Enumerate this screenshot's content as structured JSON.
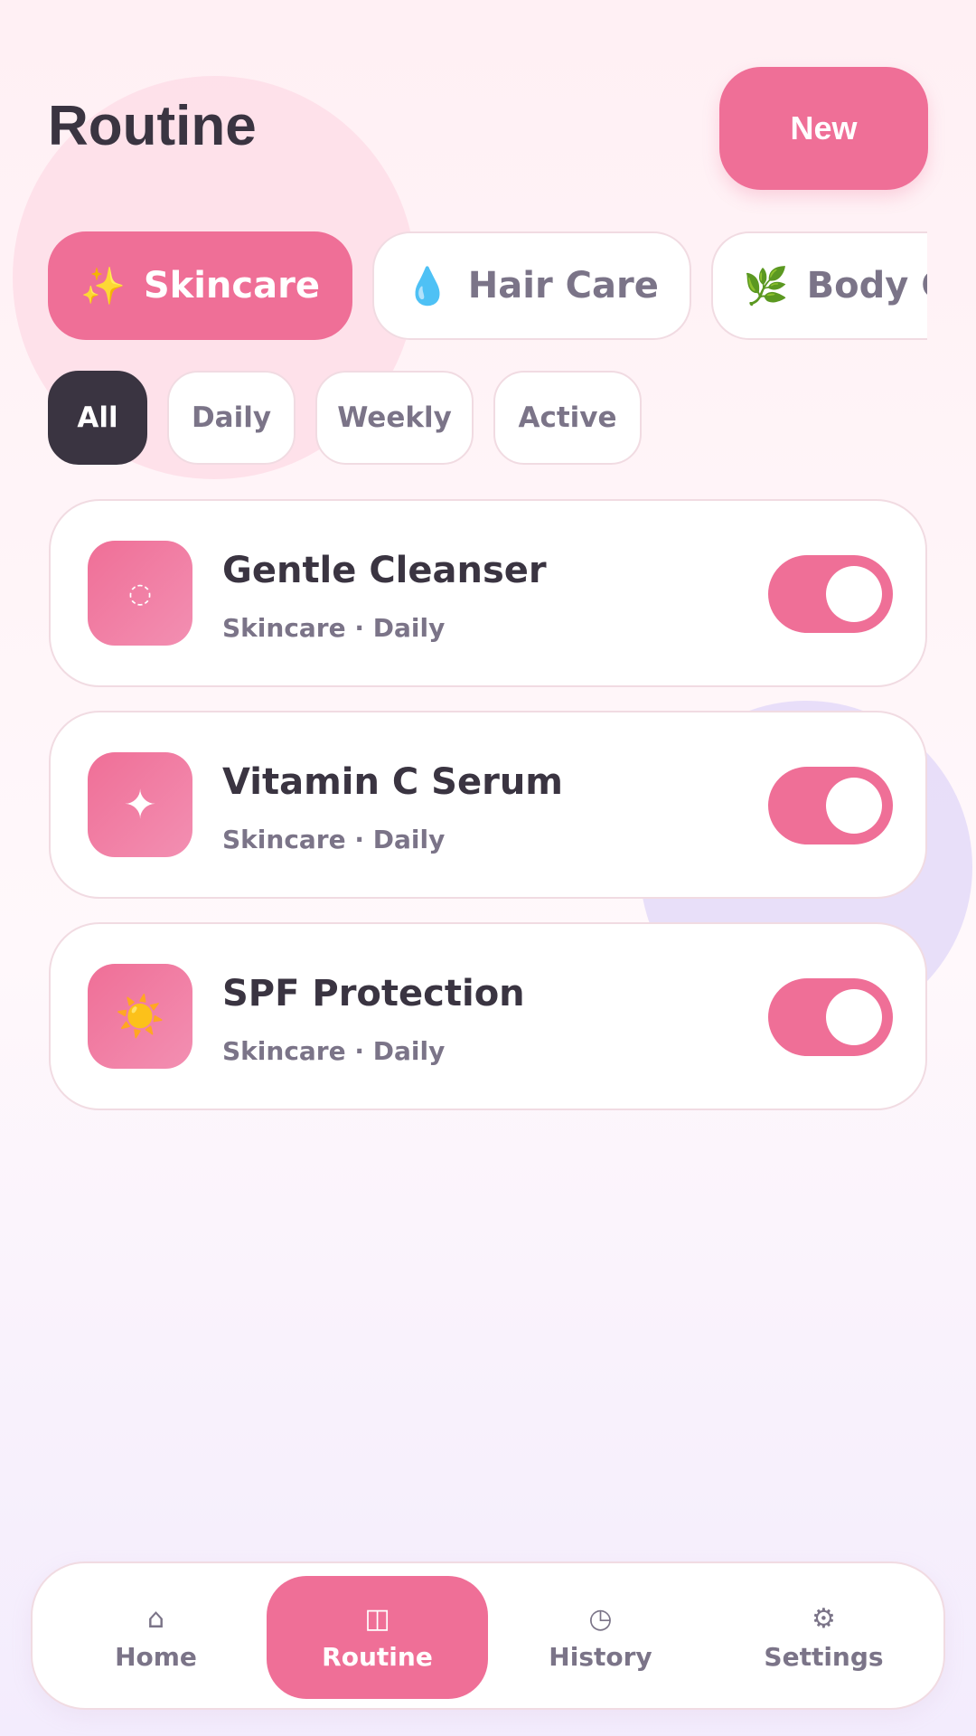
{
  "header": {
    "title": "Routine",
    "new_label": "New"
  },
  "categories": [
    {
      "icon": "sparkles-icon",
      "emoji": "✨",
      "label": "Skincare",
      "active": true
    },
    {
      "icon": "droplet-icon",
      "emoji": "💧",
      "label": "Hair Care",
      "active": false
    },
    {
      "icon": "herb-icon",
      "emoji": "🌿",
      "label": "Body Care",
      "active": false
    }
  ],
  "filters": [
    {
      "label": "All",
      "active": true
    },
    {
      "label": "Daily",
      "active": false
    },
    {
      "label": "Weekly",
      "active": false
    },
    {
      "label": "Active",
      "active": false
    }
  ],
  "routines": [
    {
      "icon": "bubble-icon",
      "glyph": "◌",
      "name": "Gentle Cleanser",
      "meta": "Skincare · Daily",
      "enabled": true
    },
    {
      "icon": "sparkle-icon",
      "glyph": "✦",
      "name": "Vitamin C Serum",
      "meta": "Skincare · Daily",
      "enabled": true
    },
    {
      "icon": "sun-icon",
      "glyph": "☀️",
      "name": "SPF Protection",
      "meta": "Skincare · Daily",
      "enabled": true
    }
  ],
  "nav": [
    {
      "icon": "home-icon",
      "glyph": "⌂",
      "label": "Home",
      "active": false
    },
    {
      "icon": "routine-icon",
      "glyph": "◫",
      "label": "Routine",
      "active": true
    },
    {
      "icon": "history-icon",
      "glyph": "◷",
      "label": "History",
      "active": false
    },
    {
      "icon": "settings-icon",
      "glyph": "⚙",
      "label": "Settings",
      "active": false
    }
  ],
  "colors": {
    "accent": "#ef6f97",
    "dark_chip": "#3a3441",
    "text_muted": "#7b7488"
  }
}
